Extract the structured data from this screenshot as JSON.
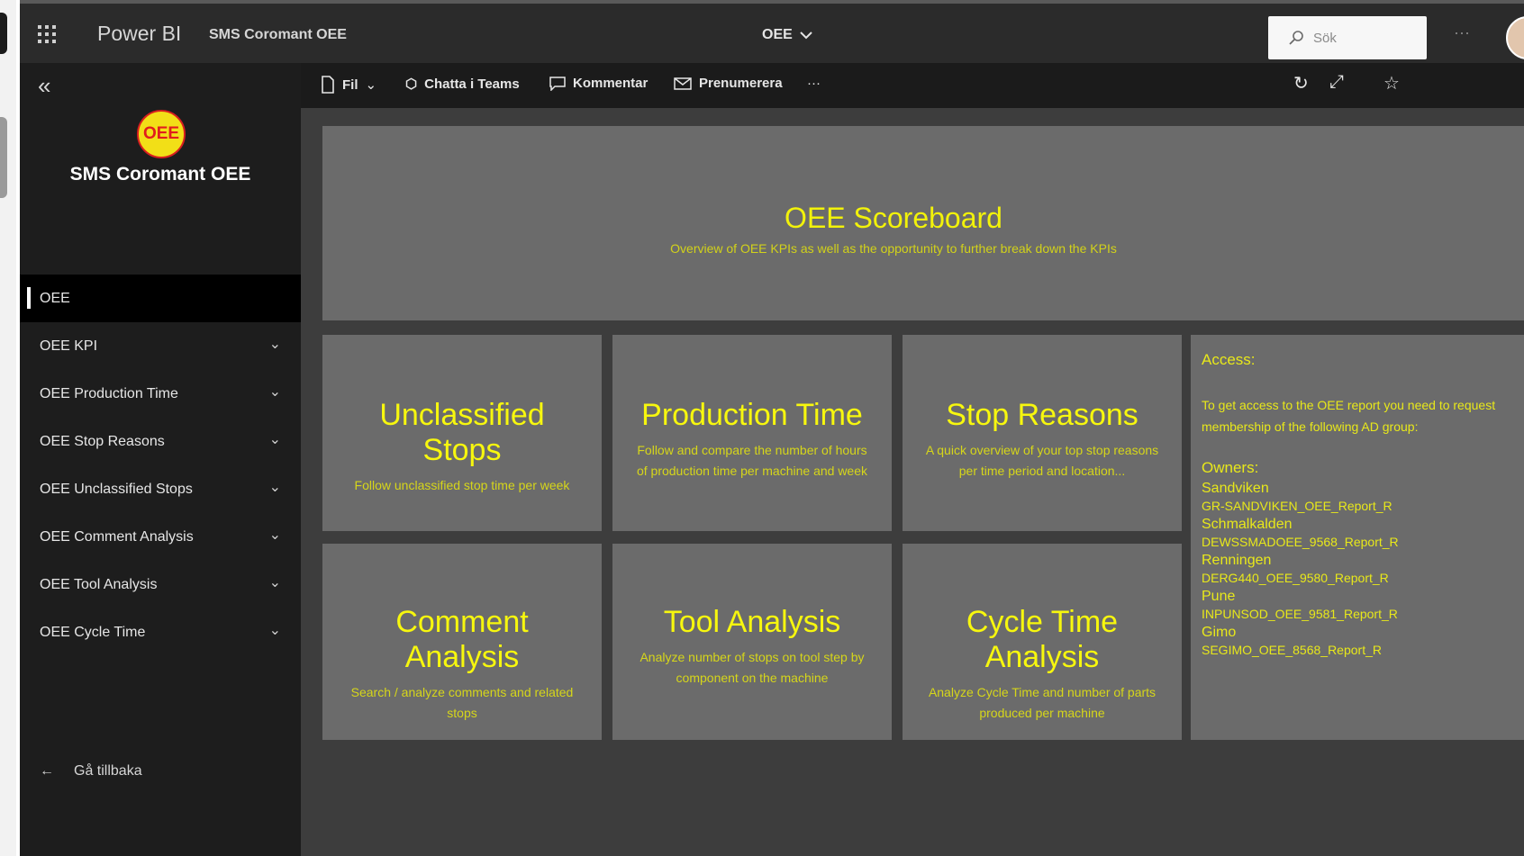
{
  "topbar": {
    "brand": "Power BI",
    "report_name": "SMS Coromant OEE",
    "page_select": "OEE",
    "search_placeholder": "Sök",
    "more": "···"
  },
  "sidebar": {
    "app_logo_text": "OEE",
    "app_title": "SMS Coromant OEE",
    "items": [
      {
        "label": "OEE",
        "active": true
      },
      {
        "label": "OEE KPI"
      },
      {
        "label": "OEE Production Time"
      },
      {
        "label": "OEE Stop Reasons"
      },
      {
        "label": "OEE Unclassified Stops"
      },
      {
        "label": "OEE Comment Analysis"
      },
      {
        "label": "OEE Tool Analysis"
      },
      {
        "label": "OEE Cycle Time"
      }
    ],
    "back_label": "Gå tillbaka"
  },
  "actionbar": {
    "file": "Fil",
    "chat": "Chatta i Teams",
    "comment": "Kommentar",
    "subscribe": "Prenumerera",
    "more": "···"
  },
  "scoreboard": {
    "title": "OEE Scoreboard",
    "subtitle": "Overview of OEE KPIs as well as the opportunity to further break down the KPIs"
  },
  "tiles": [
    {
      "title": "Unclassified Stops",
      "desc": "Follow unclassified stop time per week"
    },
    {
      "title": "Production Time",
      "desc": "Follow and compare the number of hours of production time per machine and week"
    },
    {
      "title": "Stop Reasons",
      "desc": "A quick overview of your top stop reasons per time period and location..."
    },
    {
      "title": "Comment Analysis",
      "desc": "Search / analyze comments and related stops"
    },
    {
      "title": "Tool Analysis",
      "desc": "Analyze number of stops on tool step by component on the machine"
    },
    {
      "title": "Cycle Time Analysis",
      "desc": "Analyze Cycle Time and number of parts produced per machine"
    }
  ],
  "access": {
    "heading": "Access:",
    "text": "To get access to the OEE report you need to request membership of the following AD group:",
    "owners_heading": "Owners:",
    "owners": [
      {
        "name": "Sandviken",
        "group": "GR-SANDVIKEN_OEE_Report_R"
      },
      {
        "name": "Schmalkalden",
        "group": "DEWSSMADOEE_9568_Report_R"
      },
      {
        "name": "Renningen",
        "group": "DERG440_OEE_9580_Report_R"
      },
      {
        "name": "Pune",
        "group": "INPUNSOD_OEE_9581_Report_R"
      },
      {
        "name": "Gimo",
        "group": "SEGIMO_OEE_8568_Report_R"
      }
    ]
  }
}
